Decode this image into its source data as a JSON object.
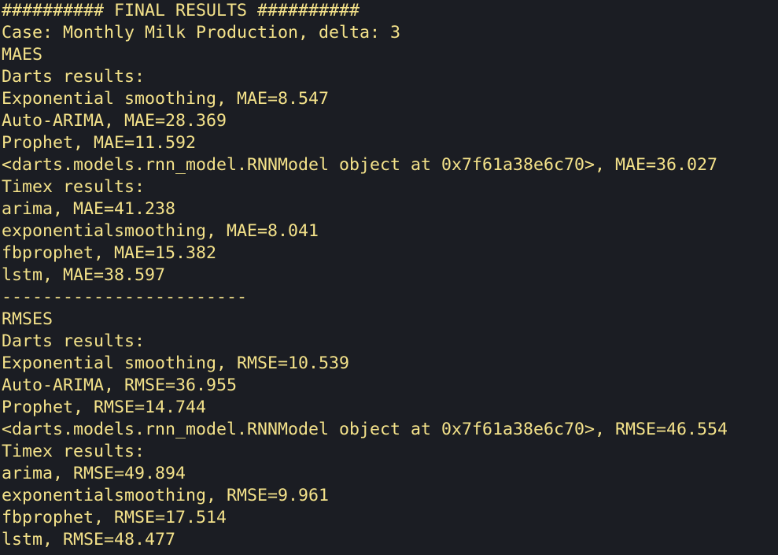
{
  "terminal": {
    "text_color": "#f4e28a",
    "background_color": "#1b1d23",
    "lines": [
      "########## FINAL RESULTS ##########",
      "Case: Monthly Milk Production, delta: 3",
      "MAES",
      "Darts results:",
      "Exponential smoothing, MAE=8.547",
      "Auto-ARIMA, MAE=28.369",
      "Prophet, MAE=11.592",
      "<darts.models.rnn_model.RNNModel object at 0x7f61a38e6c70>, MAE=36.027",
      "Timex results:",
      "arima, MAE=41.238",
      "exponentialsmoothing, MAE=8.041",
      "fbprophet, MAE=15.382",
      "lstm, MAE=38.597",
      "------------------------",
      "RMSES",
      "Darts results:",
      "Exponential smoothing, RMSE=10.539",
      "Auto-ARIMA, RMSE=36.955",
      "Prophet, RMSE=14.744",
      "<darts.models.rnn_model.RNNModel object at 0x7f61a38e6c70>, RMSE=46.554",
      "Timex results:",
      "arima, RMSE=49.894",
      "exponentialsmoothing, RMSE=9.961",
      "fbprophet, RMSE=17.514",
      "lstm, RMSE=48.477"
    ]
  }
}
